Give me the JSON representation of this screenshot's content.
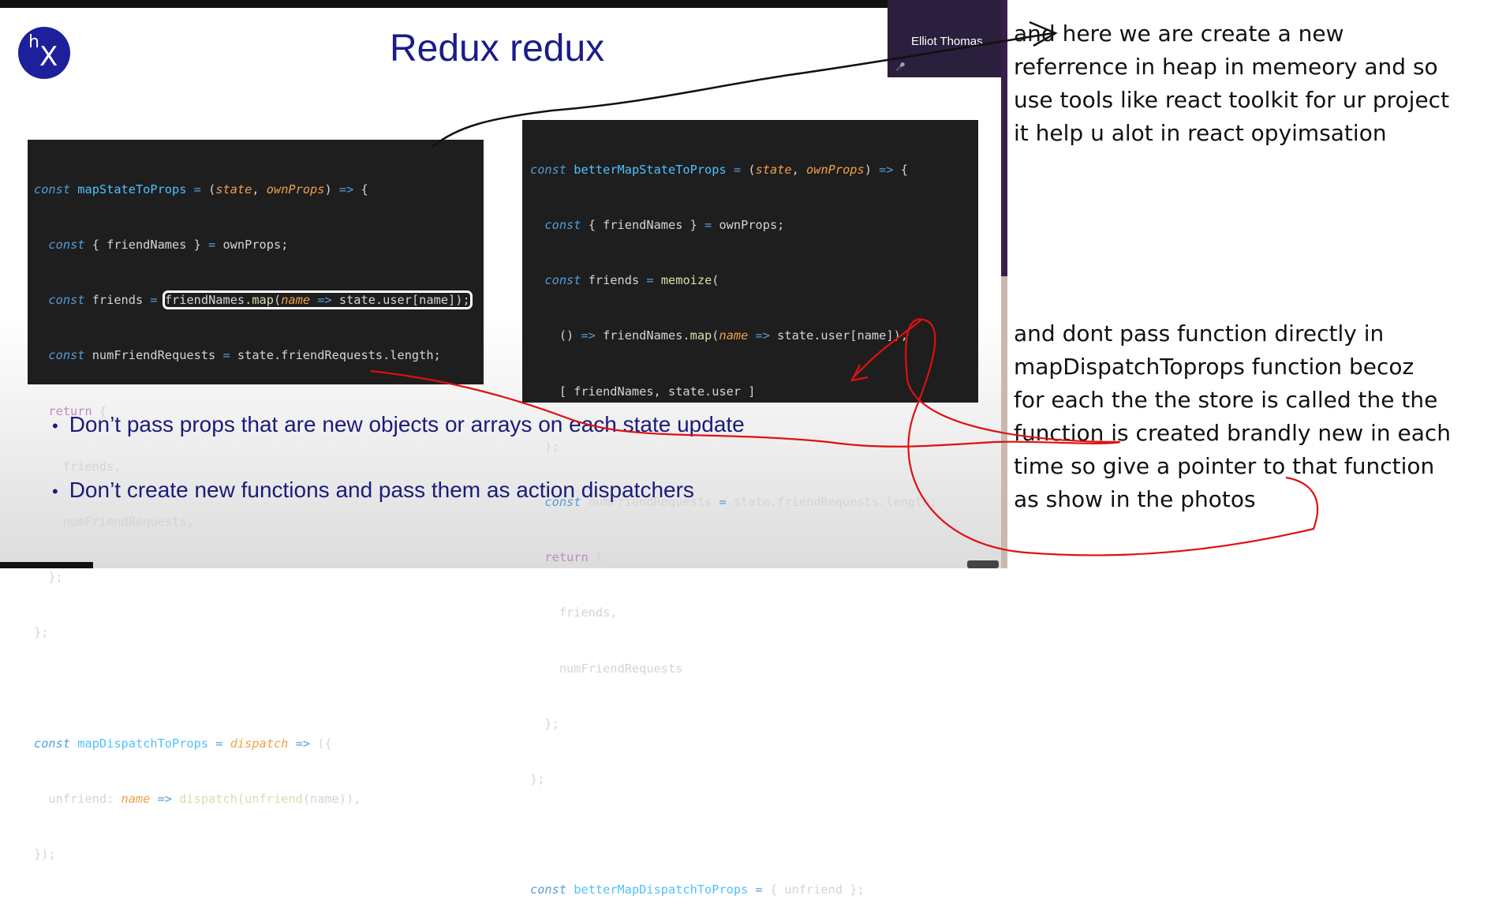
{
  "slide": {
    "title": "Redux redux",
    "logo": {
      "line1": "h",
      "line2": "X",
      "color": "#1e1f9b"
    },
    "presenter": {
      "name": "Elliot Thomas"
    },
    "code_left": [
      "const mapStateToProps = (state, ownProps) => {",
      "  const { friendNames } = ownProps;",
      "  const friends = friendNames.map(name => state.user[name]);",
      "  const numFriendRequests = state.friendRequests.length;",
      "  return {",
      "    friends,",
      "    numFriendRequests,",
      "  };",
      "};",
      "",
      "const mapDispatchToProps = dispatch => ({",
      "  unfriend: name => dispatch(unfriend(name)),",
      "});"
    ],
    "code_right": [
      "const betterMapStateToProps = (state, ownProps) => {",
      "  const { friendNames } = ownProps;",
      "  const friends = memoize(",
      "    () => friendNames.map(name => state.user[name]),",
      "    [ friendNames, state.user ]",
      "  );",
      "  const numFriendRequests = state.friendRequests.length;",
      "  return {",
      "    friends,",
      "    numFriendRequests",
      "  };",
      "};",
      "",
      "const betterMapDispatchToProps = { unfriend };"
    ],
    "bullets": [
      "Don’t pass props that are new objects or arrays on each state update",
      "Don’t create new functions and pass them as action dispatchers"
    ]
  },
  "notes": {
    "note1": [
      "and here we are create a new",
      "referrence in heap in memeory and so",
      "use tools like react toolkit for ur project",
      "it help u alot in react opyimsation"
    ],
    "note2": [
      "and dont pass function directly in",
      "mapDispatchToprops function becoz",
      "for each the the store is called the the",
      "function is created brandly new in each",
      "time so give a pointer to that function",
      "as show in the photos"
    ]
  },
  "colors": {
    "title": "#1a1c8a",
    "code_bg": "#1e1e1e",
    "keyword": "#569cd6",
    "param": "#f0a04a",
    "ink_red": "#e01010"
  }
}
